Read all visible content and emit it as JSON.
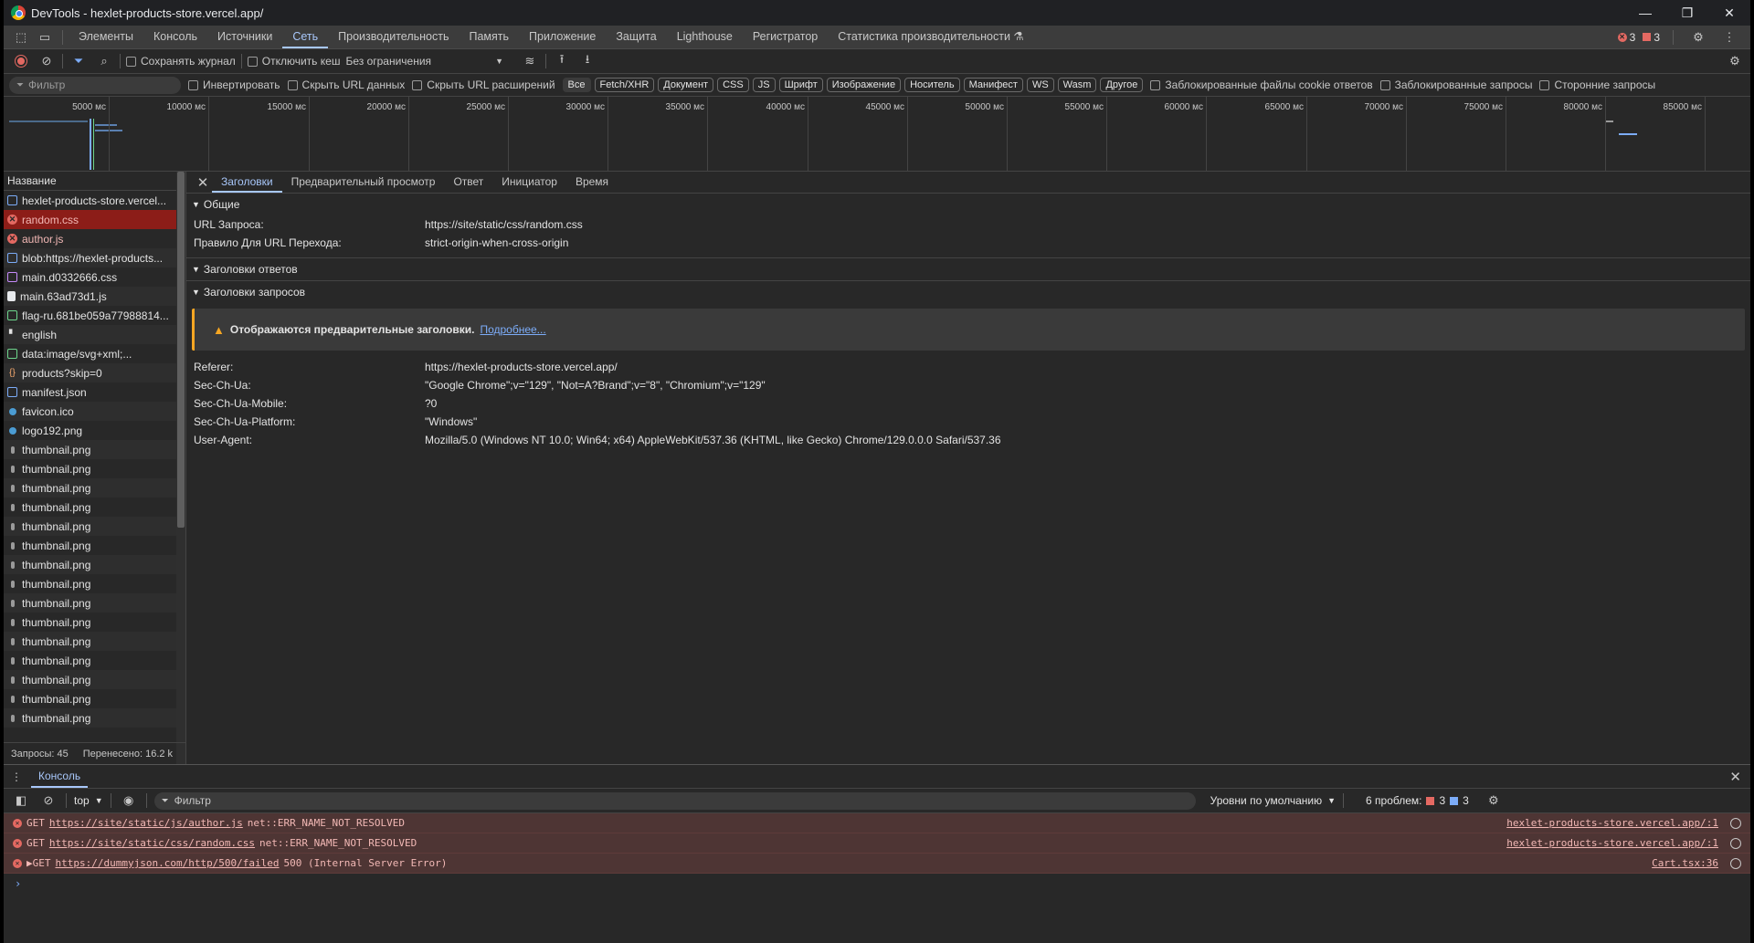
{
  "window": {
    "title": "DevTools - hexlet-products-store.vercel.app/",
    "controls": [
      "—",
      "❐",
      "✕"
    ]
  },
  "main_tabs": [
    {
      "label": "Элементы"
    },
    {
      "label": "Консоль"
    },
    {
      "label": "Источники"
    },
    {
      "label": "Сеть",
      "active": true
    },
    {
      "label": "Производительность"
    },
    {
      "label": "Память"
    },
    {
      "label": "Приложение"
    },
    {
      "label": "Защита"
    },
    {
      "label": "Lighthouse"
    },
    {
      "label": "Регистратор"
    },
    {
      "label": "Статистика производительности ⚗"
    }
  ],
  "top_counts": {
    "errors": "3",
    "warnings": "3"
  },
  "net_toolbar": {
    "preserve_log": "Сохранять журнал",
    "disable_cache": "Отключить кеш",
    "throttling": "Без ограничения"
  },
  "filter_bar": {
    "placeholder": "Фильтр",
    "invert": "Инвертировать",
    "hide_data_urls": "Скрыть URL данных",
    "hide_ext_urls": "Скрыть URL расширений",
    "types": [
      "Все",
      "Fetch/XHR",
      "Документ",
      "CSS",
      "JS",
      "Шрифт",
      "Изображение",
      "Носитель",
      "Манифест",
      "WS",
      "Wasm",
      "Другое"
    ],
    "blocked_cookies": "Заблокированные файлы cookie ответов",
    "blocked_requests": "Заблокированные запросы",
    "third_party": "Сторонние запросы"
  },
  "overview_ticks": [
    "5000 мс",
    "10000 мс",
    "15000 мс",
    "20000 мс",
    "25000 мс",
    "30000 мс",
    "35000 мс",
    "40000 мс",
    "45000 мс",
    "50000 мс",
    "55000 мс",
    "60000 мс",
    "65000 мс",
    "70000 мс",
    "75000 мс",
    "80000 мс",
    "85000 мс"
  ],
  "request_list": {
    "header": "Название",
    "rows": [
      {
        "name": "hexlet-products-store.vercel...",
        "icon": "doc"
      },
      {
        "name": "random.css",
        "icon": "err",
        "status": "selected"
      },
      {
        "name": "author.js",
        "icon": "err",
        "status": "error"
      },
      {
        "name": "blob:https://hexlet-products...",
        "icon": "doc"
      },
      {
        "name": "main.d0332666.css",
        "icon": "css"
      },
      {
        "name": "main.63ad73d1.js",
        "icon": "js"
      },
      {
        "name": "flag-ru.681be059a77988814...",
        "icon": "img"
      },
      {
        "name": "english",
        "icon": "font"
      },
      {
        "name": "data:image/svg+xml;...",
        "icon": "img"
      },
      {
        "name": "products?skip=0",
        "icon": "fetch"
      },
      {
        "name": "manifest.json",
        "icon": "doc"
      },
      {
        "name": "favicon.ico",
        "icon": "ico"
      },
      {
        "name": "logo192.png",
        "icon": "ico"
      },
      {
        "name": "thumbnail.png",
        "icon": "thumb"
      },
      {
        "name": "thumbnail.png",
        "icon": "thumb"
      },
      {
        "name": "thumbnail.png",
        "icon": "thumb"
      },
      {
        "name": "thumbnail.png",
        "icon": "thumb"
      },
      {
        "name": "thumbnail.png",
        "icon": "thumb"
      },
      {
        "name": "thumbnail.png",
        "icon": "thumb"
      },
      {
        "name": "thumbnail.png",
        "icon": "thumb"
      },
      {
        "name": "thumbnail.png",
        "icon": "thumb"
      },
      {
        "name": "thumbnail.png",
        "icon": "thumb"
      },
      {
        "name": "thumbnail.png",
        "icon": "thumb"
      },
      {
        "name": "thumbnail.png",
        "icon": "thumb"
      },
      {
        "name": "thumbnail.png",
        "icon": "thumb"
      },
      {
        "name": "thumbnail.png",
        "icon": "thumb"
      },
      {
        "name": "thumbnail.png",
        "icon": "thumb"
      },
      {
        "name": "thumbnail.png",
        "icon": "thumb"
      }
    ],
    "status": {
      "requests": "Запросы: 45",
      "transferred": "Перенесено: 16.2 k"
    }
  },
  "details": {
    "tabs": [
      {
        "label": "Заголовки",
        "active": true
      },
      {
        "label": "Предварительный просмотр"
      },
      {
        "label": "Ответ"
      },
      {
        "label": "Инициатор"
      },
      {
        "label": "Время"
      }
    ],
    "general": {
      "title": "Общие",
      "rows": [
        {
          "k": "URL Запроса:",
          "v": "https://site/static/css/random.css"
        },
        {
          "k": "Правило Для URL Перехода:",
          "v": "strict-origin-when-cross-origin"
        }
      ]
    },
    "response_headers": {
      "title": "Заголовки ответов"
    },
    "request_headers": {
      "title": "Заголовки запросов",
      "notice": "Отображаются предварительные заголовки.",
      "notice_link": "Подробнее...",
      "rows": [
        {
          "k": "Referer:",
          "v": "https://hexlet-products-store.vercel.app/"
        },
        {
          "k": "Sec-Ch-Ua:",
          "v": "\"Google Chrome\";v=\"129\", \"Not=A?Brand\";v=\"8\", \"Chromium\";v=\"129\""
        },
        {
          "k": "Sec-Ch-Ua-Mobile:",
          "v": "?0"
        },
        {
          "k": "Sec-Ch-Ua-Platform:",
          "v": "\"Windows\""
        },
        {
          "k": "User-Agent:",
          "v": "Mozilla/5.0 (Windows NT 10.0; Win64; x64) AppleWebKit/537.36 (KHTML, like Gecko) Chrome/129.0.0.0 Safari/537.36"
        }
      ]
    }
  },
  "drawer": {
    "tab": "Консоль",
    "context": "top",
    "filter_placeholder": "Фильтр",
    "levels": "Уровни по умолчанию",
    "issues_label": "6 проблем:",
    "issues_errors": "3",
    "issues_info": "3",
    "logs": [
      {
        "prefix": "GET",
        "url": "https://site/static/js/author.js",
        "msg": "net::ERR_NAME_NOT_RESOLVED",
        "src": "hexlet-products-store.vercel.app/:1"
      },
      {
        "prefix": "GET",
        "url": "https://site/static/css/random.css",
        "msg": "net::ERR_NAME_NOT_RESOLVED",
        "src": "hexlet-products-store.vercel.app/:1"
      },
      {
        "prefix": "▶GET",
        "url": "https://dummyjson.com/http/500/failed",
        "msg": "500 (Internal Server Error)",
        "src": "Cart.tsx:36"
      }
    ],
    "prompt": "›"
  }
}
